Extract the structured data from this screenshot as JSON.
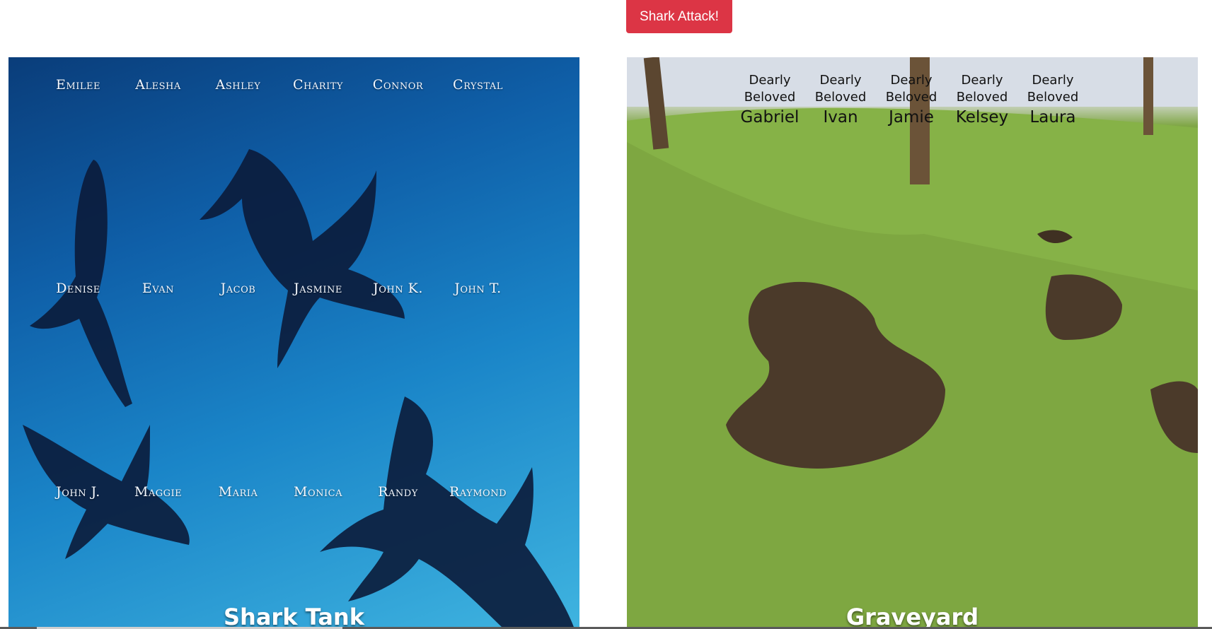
{
  "toolbar": {
    "attack_label": "Shark Attack!"
  },
  "shark_tank": {
    "title": "Shark Tank",
    "rows": [
      [
        "Emilee",
        "Alesha",
        "Ashley",
        "Charity",
        "Connor",
        "Crystal"
      ],
      [
        "Denise",
        "Evan",
        "Jacob",
        "Jasmine",
        "John K.",
        "John T."
      ],
      [
        "John J.",
        "Maggie",
        "Maria",
        "Monica",
        "Randy",
        "Raymond"
      ]
    ]
  },
  "graveyard": {
    "title": "Graveyard",
    "graves": [
      {
        "epitaph_1": "Dearly",
        "epitaph_2": "Beloved",
        "name": "Gabriel"
      },
      {
        "epitaph_1": "Dearly",
        "epitaph_2": "Beloved",
        "name": "Ivan"
      },
      {
        "epitaph_1": "Dearly",
        "epitaph_2": "Beloved",
        "name": "Jamie"
      },
      {
        "epitaph_1": "Dearly",
        "epitaph_2": "Beloved",
        "name": "Kelsey"
      },
      {
        "epitaph_1": "Dearly",
        "epitaph_2": "Beloved",
        "name": "Laura"
      }
    ]
  },
  "colors": {
    "attack_button": "#dc3545",
    "water": "#1a85c8",
    "grass": "#8cb84a"
  }
}
